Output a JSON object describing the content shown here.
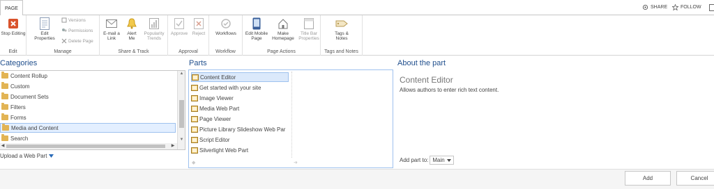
{
  "topbar": {
    "page_tab": "PAGE",
    "share_label": "SHARE",
    "follow_label": "FOLLOW"
  },
  "ribbon": {
    "edit_group": {
      "label": "Edit",
      "stop_editing": "Stop Editing"
    },
    "manage_group": {
      "label": "Manage",
      "edit_properties_1": "Edit",
      "edit_properties_2": "Properties",
      "versions": "Versions",
      "permissions": "Permissions",
      "delete_page": "Delete Page"
    },
    "share_group": {
      "label": "Share & Track",
      "email_1": "E-mail a",
      "email_2": "Link",
      "alert_1": "Alert",
      "alert_2": "Me",
      "popularity_1": "Popularity",
      "popularity_2": "Trends"
    },
    "approval_group": {
      "label": "Approval",
      "approve": "Approve",
      "reject": "Reject"
    },
    "workflow_group": {
      "label": "Workflow",
      "workflows": "Workflows"
    },
    "page_actions_group": {
      "label": "Page Actions",
      "edit_mobile_1": "Edit Mobile",
      "edit_mobile_2": "Page",
      "homepage_1": "Make",
      "homepage_2": "Homepage",
      "titlebar_1": "Title Bar",
      "titlebar_2": "Properties"
    },
    "tags_group": {
      "label": "Tags and Notes",
      "tags_1": "Tags &",
      "tags_2": "Notes"
    }
  },
  "categories": {
    "title": "Categories",
    "items": [
      "Content Rollup",
      "Custom",
      "Document Sets",
      "Filters",
      "Forms",
      "Media and Content",
      "Search"
    ],
    "upload": "Upload a Web Part"
  },
  "parts": {
    "title": "Parts",
    "items": [
      "Content Editor",
      "Get started with your site",
      "Image Viewer",
      "Media Web Part",
      "Page Viewer",
      "Picture Library Slideshow Web Par",
      "Script Editor",
      "Silverlight Web Part"
    ]
  },
  "about": {
    "title": "About the part",
    "name": "Content Editor",
    "description": "Allows authors to enter rich text content.",
    "add_part_label": "Add part to:",
    "zone_value": "Main"
  },
  "actions": {
    "add": "Add",
    "cancel": "Cancel"
  },
  "colors": {
    "accent": "#1f4e8c",
    "selection": "#e3efff",
    "selection_border": "#9ec1ee"
  }
}
